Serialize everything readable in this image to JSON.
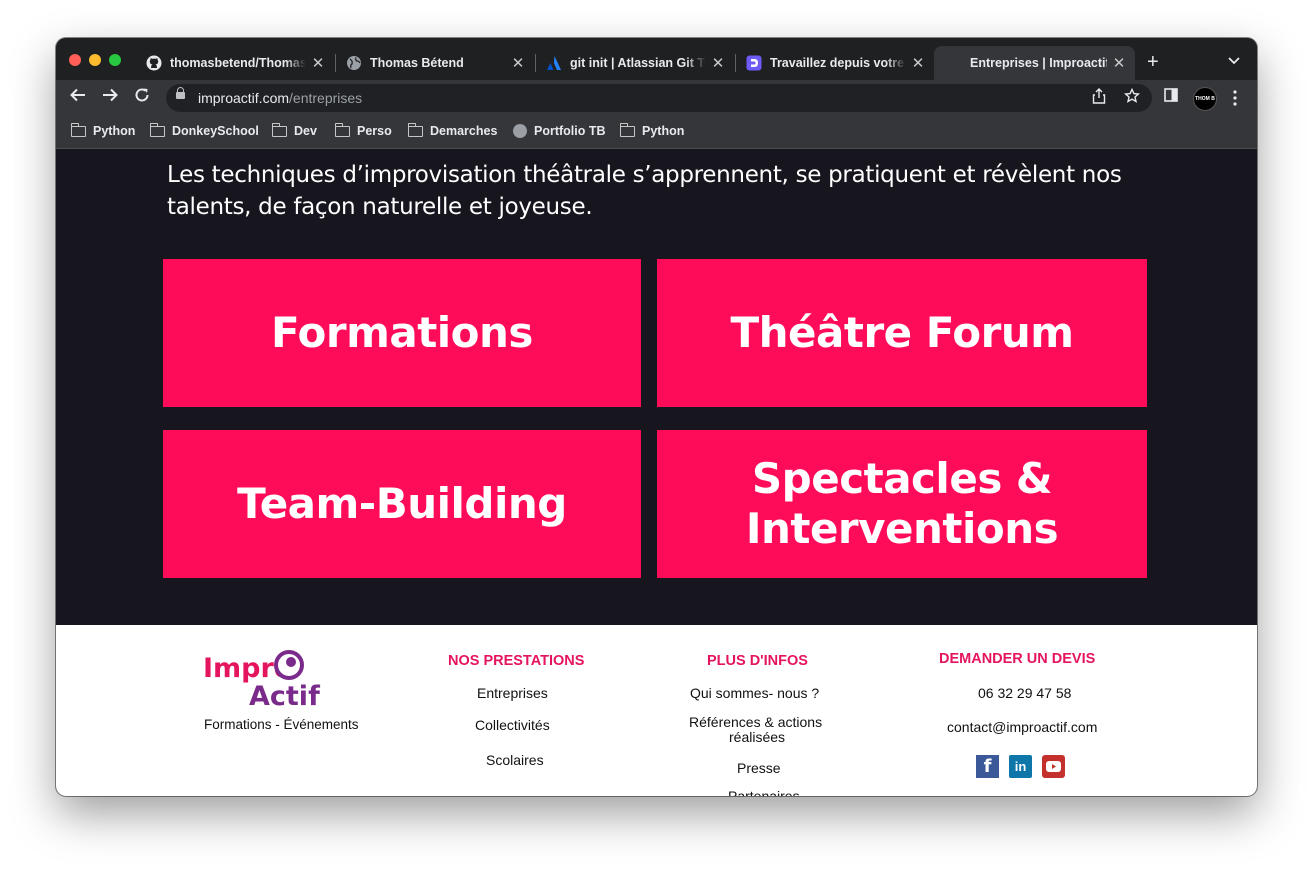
{
  "browser": {
    "tabs": [
      {
        "title": "thomasbetend/ThomasB",
        "icon": "github-icon"
      },
      {
        "title": "Thomas Bétend",
        "icon": "globe-icon"
      },
      {
        "title": "git init | Atlassian Git Tut",
        "icon": "atlassian-icon"
      },
      {
        "title": "Travaillez depuis votre d",
        "icon": "doctolib-icon"
      },
      {
        "title": "Entreprises | Improactif",
        "icon": "none"
      }
    ],
    "new_tab": "+",
    "url_host": "improactif.com",
    "url_path": "/entreprises",
    "profile_label": "THOM B",
    "bookmarks": [
      "Python",
      "DonkeySchool",
      "Dev",
      "Perso",
      "Demarches",
      "Portfolio TB",
      "Python"
    ]
  },
  "page": {
    "intro": "Les techniques d’improvisation théâtrale s’apprennent, se pratiquent et révèlent nos talents, de façon naturelle et joyeuse.",
    "cards": {
      "formations": "Formations",
      "theatre_forum": "Théâtre Forum",
      "team_building": "Team-Building",
      "spectacles_line1": "Spectacles &",
      "spectacles_line2": "Interventions"
    },
    "accent_color": "#fe0c5a",
    "background_color": "#17161f"
  },
  "footer": {
    "logo_text_1": "Impro",
    "logo_text_2": "Actif",
    "tagline": "Formations - Événements",
    "prestations": {
      "heading": "NOS PRESTATIONS",
      "items": [
        "Entreprises",
        "Collectivités",
        "Scolaires"
      ]
    },
    "infos": {
      "heading": "PLUS D'INFOS",
      "items": [
        "Qui sommes- nous ?",
        "Références & actions",
        "réalisées",
        "Presse",
        "Partenaires"
      ]
    },
    "devis": {
      "heading": "DEMANDER UN DEVIS",
      "phone": "06 32 29 47 58",
      "email": "contact@improactif.com",
      "social": [
        "facebook-icon",
        "linkedin-icon",
        "youtube-icon"
      ]
    }
  }
}
